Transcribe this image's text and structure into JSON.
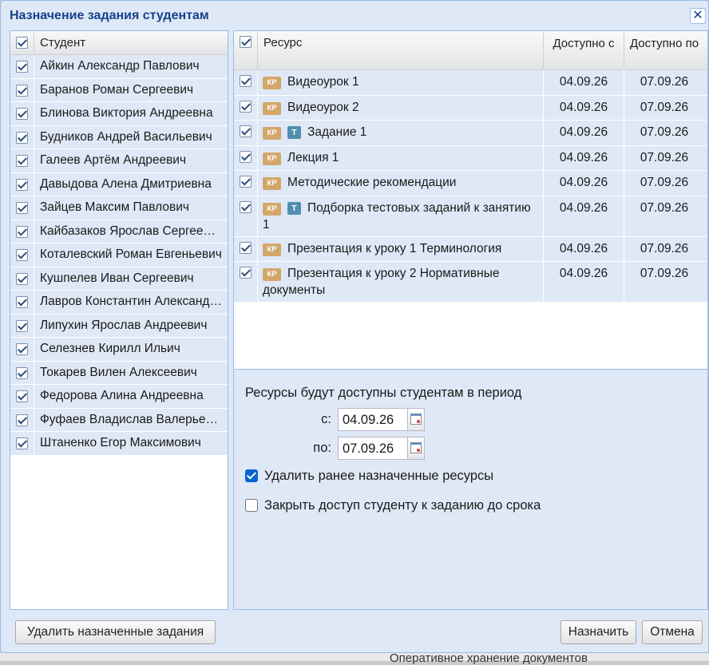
{
  "background": {
    "text": "Оперативное хранение документов"
  },
  "dialog": {
    "title": "Назначение задания студентам",
    "close_symbol": "✕"
  },
  "students": {
    "header": "Студент",
    "items": [
      "Айкин Александр Павлович",
      "Баранов Роман Сергеевич",
      "Блинова Виктория Андреевна",
      "Будников Андрей Васильевич",
      "Галеев Артём Андреевич",
      "Давыдова Алена Дмитриевна",
      "Зайцев Максим Павлович",
      "Кайбазаков Ярослав Сергеевич",
      "Коталевский Роман Евгеньевич",
      "Кушпелев Иван Сергеевич",
      "Лавров Константин Александрович",
      "Липухин Ярослав Андреевич",
      "Селезнев Кирилл Ильич",
      "Токарев Вилен Алексеевич",
      "Федорова Алина Андреевна",
      "Фуфаев Владислав Валерьевич",
      "Штаненко Егор Максимович"
    ]
  },
  "resources": {
    "headers": {
      "resource": "Ресурс",
      "available_from": "Доступно с",
      "available_to": "Доступно по"
    },
    "badges": {
      "kp": "КР",
      "t": "Т"
    },
    "rows": [
      {
        "title": "Видеоурок 1",
        "test": false,
        "from": "04.09.26",
        "to": "07.09.26"
      },
      {
        "title": "Видеоурок 2",
        "test": false,
        "from": "04.09.26",
        "to": "07.09.26"
      },
      {
        "title": "Задание 1",
        "test": true,
        "from": "04.09.26",
        "to": "07.09.26"
      },
      {
        "title": "Лекция 1",
        "test": false,
        "from": "04.09.26",
        "to": "07.09.26"
      },
      {
        "title": "Методические рекомендации",
        "test": false,
        "from": "04.09.26",
        "to": "07.09.26"
      },
      {
        "title": "Подборка тестовых заданий к занятию 1",
        "test": true,
        "from": "04.09.26",
        "to": "07.09.26"
      },
      {
        "title": "Презентация к уроку 1 Терминология",
        "test": false,
        "from": "04.09.26",
        "to": "07.09.26"
      },
      {
        "title": "Презентация к уроку 2 Нормативные документы",
        "test": false,
        "from": "04.09.26",
        "to": "07.09.26"
      }
    ]
  },
  "period": {
    "text": "Ресурсы будут доступны студентам в период",
    "from_label": "с:",
    "from_value": "04.09.26",
    "to_label": "по:",
    "to_value": "07.09.26"
  },
  "options": {
    "delete_previous": {
      "label": "Удалить ранее назначенные ресурсы",
      "checked": true
    },
    "close_access": {
      "label": "Закрыть доступ студенту к заданию до срока",
      "checked": false
    }
  },
  "buttons": {
    "delete_assigned": "Удалить назначенные задания",
    "assign": "Назначить",
    "cancel": "Отмена"
  }
}
